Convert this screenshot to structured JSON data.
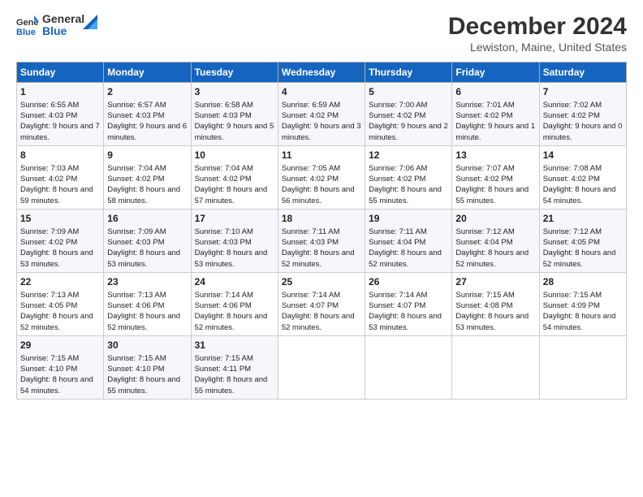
{
  "logo": {
    "line1": "General",
    "line2": "Blue"
  },
  "title": "December 2024",
  "subtitle": "Lewiston, Maine, United States",
  "days_of_week": [
    "Sunday",
    "Monday",
    "Tuesday",
    "Wednesday",
    "Thursday",
    "Friday",
    "Saturday"
  ],
  "weeks": [
    [
      {
        "day": "1",
        "sunrise": "Sunrise: 6:55 AM",
        "sunset": "Sunset: 4:03 PM",
        "daylight": "Daylight: 9 hours and 7 minutes."
      },
      {
        "day": "2",
        "sunrise": "Sunrise: 6:57 AM",
        "sunset": "Sunset: 4:03 PM",
        "daylight": "Daylight: 9 hours and 6 minutes."
      },
      {
        "day": "3",
        "sunrise": "Sunrise: 6:58 AM",
        "sunset": "Sunset: 4:03 PM",
        "daylight": "Daylight: 9 hours and 5 minutes."
      },
      {
        "day": "4",
        "sunrise": "Sunrise: 6:59 AM",
        "sunset": "Sunset: 4:02 PM",
        "daylight": "Daylight: 9 hours and 3 minutes."
      },
      {
        "day": "5",
        "sunrise": "Sunrise: 7:00 AM",
        "sunset": "Sunset: 4:02 PM",
        "daylight": "Daylight: 9 hours and 2 minutes."
      },
      {
        "day": "6",
        "sunrise": "Sunrise: 7:01 AM",
        "sunset": "Sunset: 4:02 PM",
        "daylight": "Daylight: 9 hours and 1 minute."
      },
      {
        "day": "7",
        "sunrise": "Sunrise: 7:02 AM",
        "sunset": "Sunset: 4:02 PM",
        "daylight": "Daylight: 9 hours and 0 minutes."
      }
    ],
    [
      {
        "day": "8",
        "sunrise": "Sunrise: 7:03 AM",
        "sunset": "Sunset: 4:02 PM",
        "daylight": "Daylight: 8 hours and 59 minutes."
      },
      {
        "day": "9",
        "sunrise": "Sunrise: 7:04 AM",
        "sunset": "Sunset: 4:02 PM",
        "daylight": "Daylight: 8 hours and 58 minutes."
      },
      {
        "day": "10",
        "sunrise": "Sunrise: 7:04 AM",
        "sunset": "Sunset: 4:02 PM",
        "daylight": "Daylight: 8 hours and 57 minutes."
      },
      {
        "day": "11",
        "sunrise": "Sunrise: 7:05 AM",
        "sunset": "Sunset: 4:02 PM",
        "daylight": "Daylight: 8 hours and 56 minutes."
      },
      {
        "day": "12",
        "sunrise": "Sunrise: 7:06 AM",
        "sunset": "Sunset: 4:02 PM",
        "daylight": "Daylight: 8 hours and 55 minutes."
      },
      {
        "day": "13",
        "sunrise": "Sunrise: 7:07 AM",
        "sunset": "Sunset: 4:02 PM",
        "daylight": "Daylight: 8 hours and 55 minutes."
      },
      {
        "day": "14",
        "sunrise": "Sunrise: 7:08 AM",
        "sunset": "Sunset: 4:02 PM",
        "daylight": "Daylight: 8 hours and 54 minutes."
      }
    ],
    [
      {
        "day": "15",
        "sunrise": "Sunrise: 7:09 AM",
        "sunset": "Sunset: 4:02 PM",
        "daylight": "Daylight: 8 hours and 53 minutes."
      },
      {
        "day": "16",
        "sunrise": "Sunrise: 7:09 AM",
        "sunset": "Sunset: 4:03 PM",
        "daylight": "Daylight: 8 hours and 53 minutes."
      },
      {
        "day": "17",
        "sunrise": "Sunrise: 7:10 AM",
        "sunset": "Sunset: 4:03 PM",
        "daylight": "Daylight: 8 hours and 53 minutes."
      },
      {
        "day": "18",
        "sunrise": "Sunrise: 7:11 AM",
        "sunset": "Sunset: 4:03 PM",
        "daylight": "Daylight: 8 hours and 52 minutes."
      },
      {
        "day": "19",
        "sunrise": "Sunrise: 7:11 AM",
        "sunset": "Sunset: 4:04 PM",
        "daylight": "Daylight: 8 hours and 52 minutes."
      },
      {
        "day": "20",
        "sunrise": "Sunrise: 7:12 AM",
        "sunset": "Sunset: 4:04 PM",
        "daylight": "Daylight: 8 hours and 52 minutes."
      },
      {
        "day": "21",
        "sunrise": "Sunrise: 7:12 AM",
        "sunset": "Sunset: 4:05 PM",
        "daylight": "Daylight: 8 hours and 52 minutes."
      }
    ],
    [
      {
        "day": "22",
        "sunrise": "Sunrise: 7:13 AM",
        "sunset": "Sunset: 4:05 PM",
        "daylight": "Daylight: 8 hours and 52 minutes."
      },
      {
        "day": "23",
        "sunrise": "Sunrise: 7:13 AM",
        "sunset": "Sunset: 4:06 PM",
        "daylight": "Daylight: 8 hours and 52 minutes."
      },
      {
        "day": "24",
        "sunrise": "Sunrise: 7:14 AM",
        "sunset": "Sunset: 4:06 PM",
        "daylight": "Daylight: 8 hours and 52 minutes."
      },
      {
        "day": "25",
        "sunrise": "Sunrise: 7:14 AM",
        "sunset": "Sunset: 4:07 PM",
        "daylight": "Daylight: 8 hours and 52 minutes."
      },
      {
        "day": "26",
        "sunrise": "Sunrise: 7:14 AM",
        "sunset": "Sunset: 4:07 PM",
        "daylight": "Daylight: 8 hours and 53 minutes."
      },
      {
        "day": "27",
        "sunrise": "Sunrise: 7:15 AM",
        "sunset": "Sunset: 4:08 PM",
        "daylight": "Daylight: 8 hours and 53 minutes."
      },
      {
        "day": "28",
        "sunrise": "Sunrise: 7:15 AM",
        "sunset": "Sunset: 4:09 PM",
        "daylight": "Daylight: 8 hours and 54 minutes."
      }
    ],
    [
      {
        "day": "29",
        "sunrise": "Sunrise: 7:15 AM",
        "sunset": "Sunset: 4:10 PM",
        "daylight": "Daylight: 8 hours and 54 minutes."
      },
      {
        "day": "30",
        "sunrise": "Sunrise: 7:15 AM",
        "sunset": "Sunset: 4:10 PM",
        "daylight": "Daylight: 8 hours and 55 minutes."
      },
      {
        "day": "31",
        "sunrise": "Sunrise: 7:15 AM",
        "sunset": "Sunset: 4:11 PM",
        "daylight": "Daylight: 8 hours and 55 minutes."
      },
      null,
      null,
      null,
      null
    ]
  ]
}
